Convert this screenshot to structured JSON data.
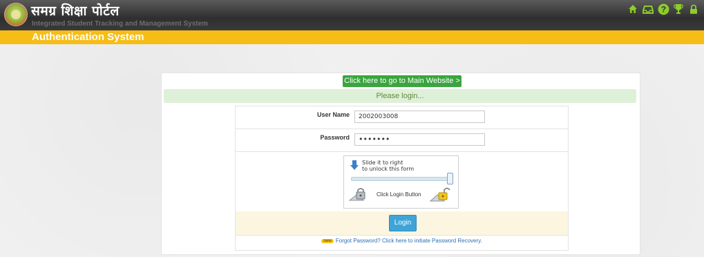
{
  "header": {
    "title": "समग्र शिक्षा पोर्टल",
    "subtitle": "Integrated Student Tracking and Management System",
    "icons": [
      "home-icon",
      "inbox-icon",
      "help-icon",
      "trophy-icon",
      "lock-icon"
    ]
  },
  "section": {
    "title": "Authentication System"
  },
  "panel": {
    "main_link": "Click here to go to Main Website >",
    "notice": "Please login..."
  },
  "form": {
    "username_label": "User Name",
    "username_value": "2002003008",
    "password_label": "Password",
    "password_value": "•••••••",
    "slider_text_1": "Slide it to right",
    "slider_text_2": "to unlock this form",
    "slider_level": 1.0,
    "click_text": "Click Login Button",
    "login_button": "Login",
    "new_badge": "new",
    "forgot_link": "Forgot Password? Click here to initiate Password Recovery."
  },
  "colors": {
    "accent_yellow": "#f6bd16",
    "link_green": "#3aa53e",
    "notice_bg": "#dff0d8",
    "login_blue": "#3fa4d8",
    "icon_green": "#8ecb2b"
  }
}
